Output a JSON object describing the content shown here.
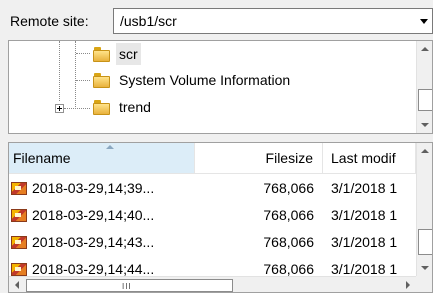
{
  "remote_site": {
    "label": "Remote site:",
    "path": "/usb1/scr"
  },
  "tree": {
    "items": [
      {
        "label": "scr",
        "selected": true,
        "expandable": false
      },
      {
        "label": "System Volume Information",
        "selected": false,
        "expandable": false
      },
      {
        "label": "trend",
        "selected": false,
        "expandable": true
      }
    ]
  },
  "file_list": {
    "columns": [
      {
        "label": "Filename",
        "sorted": true
      },
      {
        "label": "Filesize",
        "sorted": false
      },
      {
        "label": "Last modif",
        "sorted": false
      }
    ],
    "rows": [
      {
        "filename": "2018-03-29,14;39...",
        "filesize": "768,066",
        "modified": "3/1/2018 1"
      },
      {
        "filename": "2018-03-29,14;40...",
        "filesize": "768,066",
        "modified": "3/1/2018 1"
      },
      {
        "filename": "2018-03-29,14;43...",
        "filesize": "768,066",
        "modified": "3/1/2018 1"
      },
      {
        "filename": "2018-03-29,14;44...",
        "filesize": "768,066",
        "modified": "3/1/2018 1"
      }
    ],
    "scroll_grip": "III"
  }
}
